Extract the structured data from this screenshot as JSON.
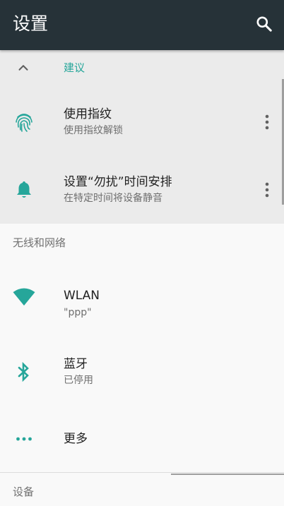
{
  "appbar": {
    "title": "设置",
    "action_icon": "search-icon"
  },
  "suggestions": {
    "header": "建议",
    "collapse_icon": "chevron-up-icon",
    "items": [
      {
        "title": "使用指纹",
        "subtitle": "使用指纹解锁",
        "icon": "fingerprint-icon"
      },
      {
        "title": "设置“勿扰”时间安排",
        "subtitle": "在特定时间将设备静音",
        "icon": "bell-icon"
      }
    ]
  },
  "wireless": {
    "section_title": "无线和网络",
    "items": [
      {
        "title": "WLAN",
        "subtitle": "\"ppp\"",
        "icon": "wifi-icon"
      },
      {
        "title": "蓝牙",
        "subtitle": "已停用",
        "icon": "bluetooth-icon"
      },
      {
        "title": "更多",
        "icon": "more-horiz-icon"
      }
    ]
  },
  "device": {
    "section_title": "设备"
  },
  "colors": {
    "appbar": "#263238",
    "accent": "#26a69a",
    "suggestion_bg": "#ebebeb",
    "background": "#f9f9f9"
  }
}
